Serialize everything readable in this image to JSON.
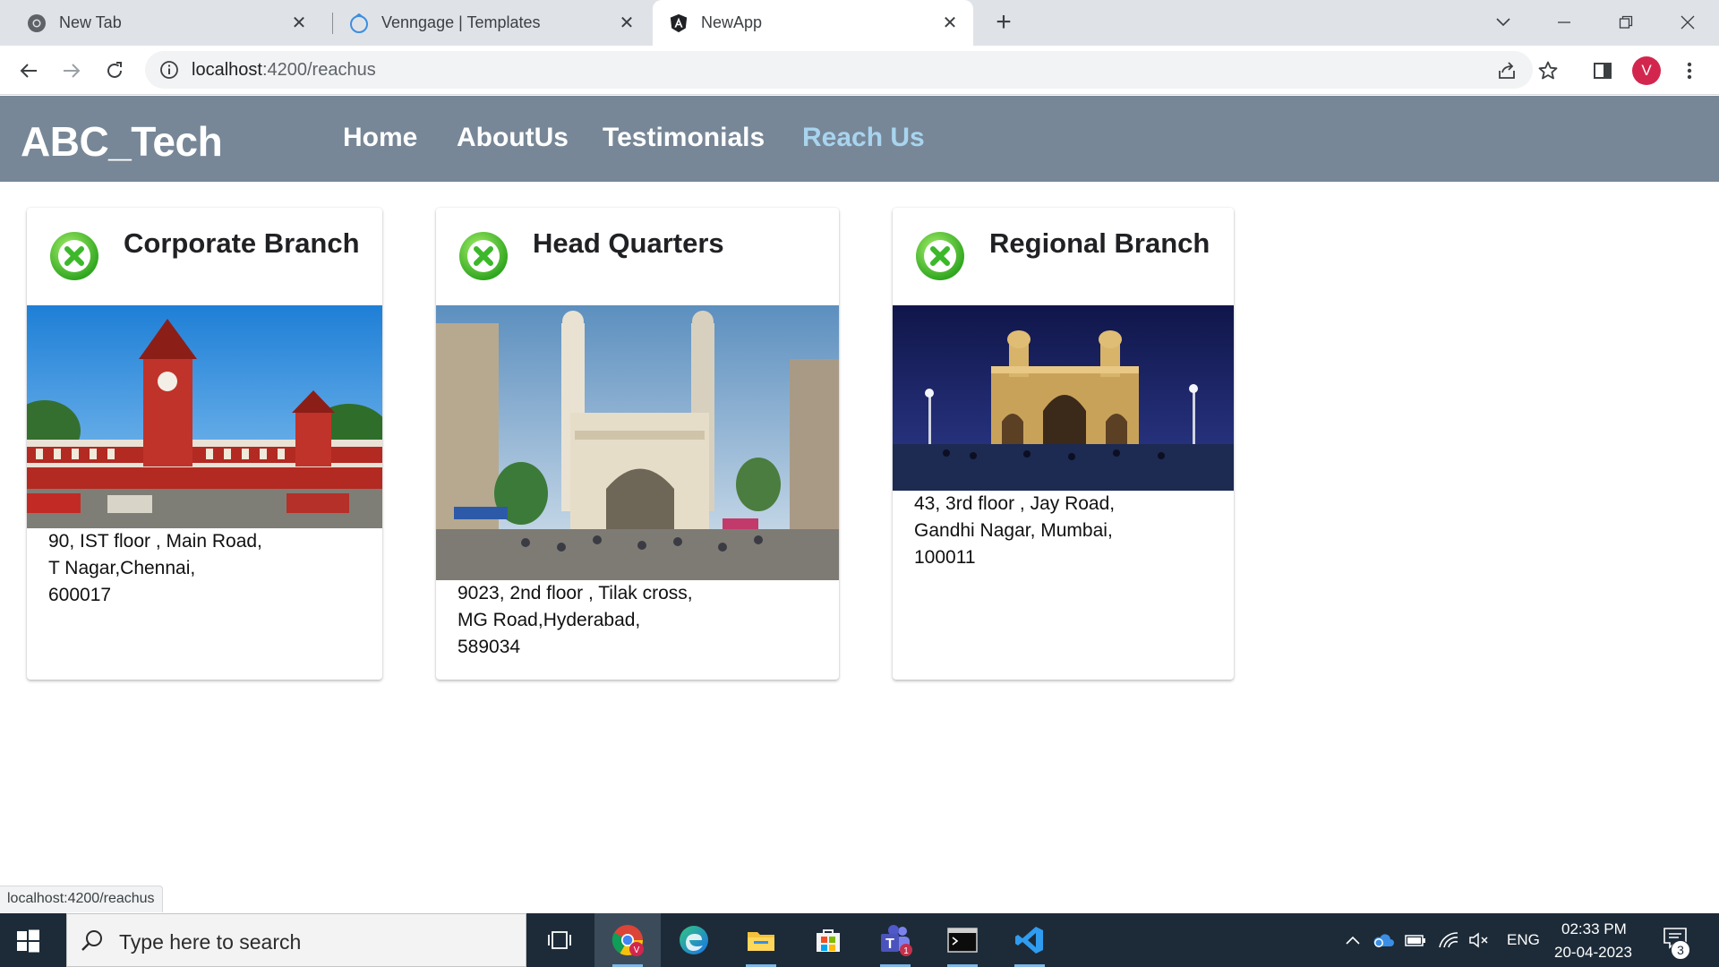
{
  "browser": {
    "tabs": [
      {
        "title": "New Tab",
        "icon": "chrome-icon",
        "active": false
      },
      {
        "title": "Venngage | Templates",
        "icon": "venngage-icon",
        "active": false
      },
      {
        "title": "NewApp",
        "icon": "angular-icon",
        "active": true
      }
    ],
    "url_host": "localhost",
    "url_path": ":4200/reachus",
    "profile_initial": "V",
    "status_url": "localhost:4200/reachus"
  },
  "app": {
    "brand": "ABC_Tech",
    "nav": [
      {
        "label": "Home",
        "active": false
      },
      {
        "label": "AboutUs",
        "active": false
      },
      {
        "label": "Testimonials",
        "active": false
      },
      {
        "label": "Reach Us",
        "active": true
      }
    ],
    "accent_color": "#778797",
    "active_nav_color": "#a8d4ef",
    "cards": [
      {
        "title": "Corporate Branch",
        "icon": "close-circle-icon",
        "image": "chennai-central-station-photo",
        "address": [
          "90, IST floor , Main Road,",
          "T Nagar,Chennai,",
          "600017"
        ]
      },
      {
        "title": "Head Quarters",
        "icon": "close-circle-icon",
        "image": "charminar-hyderabad-photo",
        "address": [
          "9023, 2nd floor , Tilak cross,",
          "MG Road,Hyderabad,",
          "589034"
        ]
      },
      {
        "title": "Regional Branch",
        "icon": "close-circle-icon",
        "image": "gateway-of-india-mumbai-photo",
        "address": [
          "43, 3rd floor , Jay Road,",
          "Gandhi Nagar, Mumbai,",
          "100011"
        ]
      }
    ]
  },
  "taskbar": {
    "search_placeholder": "Type here to search",
    "language": "ENG",
    "time": "02:33 PM",
    "date": "20-04-2023",
    "notification_count": "3",
    "teams_badge": "1"
  }
}
